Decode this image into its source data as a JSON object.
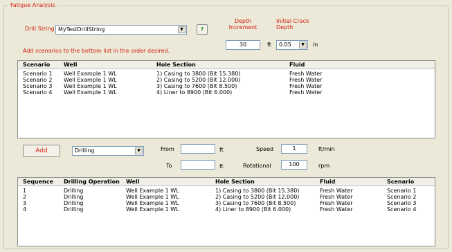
{
  "fieldset_title": "Fatigue Analysis",
  "drill_string": {
    "label": "Drill String",
    "value": "MyTestDrillString",
    "info_button": "?"
  },
  "depth_increment": {
    "label_line1": "Depth",
    "label_line2": "Increment",
    "value": "30",
    "unit": "ft"
  },
  "initial_crack_depth": {
    "label_line1": "Initial Crack",
    "label_line2": "Depth",
    "value": "0.05",
    "unit": "in"
  },
  "instruction": "Add scenarios to the bottom list in the order desired.",
  "scenarios": {
    "headers": [
      "Scenario",
      "Well",
      "Hole Section",
      "Fluid"
    ],
    "rows": [
      [
        "Scenario 1",
        "Well Example 1 WL",
        "1) Casing to 3800 (Bit 15.380)",
        "Fresh Water"
      ],
      [
        "Scenario 2",
        "Well Example 1 WL",
        "2) Casing to 5200 (Bit 12.000)",
        "Fresh Water"
      ],
      [
        "Scenario 3",
        "Well Example 1 WL",
        "3) Casing to 7600 (Bit 8.500)",
        "Fresh Water"
      ],
      [
        "Scenario 4",
        "Well Example 1 WL",
        "4) Liner to 8900 (Bit 6.000)",
        "Fresh Water"
      ]
    ]
  },
  "add_button": "Add",
  "operation": {
    "value": "Drilling"
  },
  "from": {
    "label": "From",
    "value": "",
    "unit": "ft"
  },
  "to": {
    "label": "To",
    "value": "",
    "unit": "ft"
  },
  "speed": {
    "label": "Speed",
    "value": "1",
    "unit": "ft/min"
  },
  "rotational": {
    "label": "Rotational",
    "value": "100",
    "unit": "rpm"
  },
  "sequence": {
    "headers": [
      "Sequence",
      "Drilling Operation",
      "Well",
      "Hole Section",
      "Fluid",
      "Scenario"
    ],
    "rows": [
      [
        "1",
        "Drilling",
        "Well Example 1 WL",
        "1) Casing to 3800 (Bit 15.380)",
        "Fresh Water",
        "Scenario 1"
      ],
      [
        "2",
        "Drilling",
        "Well Example 1 WL",
        "2) Casing to 5200 (Bit 12.000)",
        "Fresh Water",
        "Scenario 2"
      ],
      [
        "3",
        "Drilling",
        "Well Example 1 WL",
        "3) Casing to 7600 (Bit 8.500)",
        "Fresh Water",
        "Scenario 3"
      ],
      [
        "4",
        "Drilling",
        "Well Example 1 WL",
        "4) Liner to 8900 (Bit 6.000)",
        "Fresh Water",
        "Scenario 4"
      ]
    ]
  },
  "colors": {
    "accent_red": "#d02010",
    "background": "#ECE9D8",
    "help_green": "#2e9a2e"
  },
  "icons": {
    "info": "question-icon",
    "dropdown": "chevron-down-icon"
  }
}
